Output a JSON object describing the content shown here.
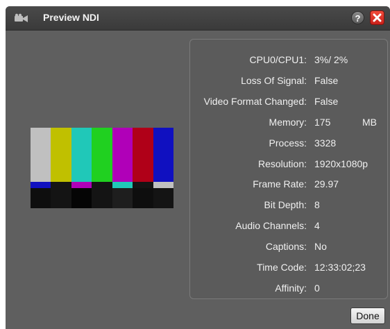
{
  "window": {
    "title": "Preview NDI",
    "help_label": "?",
    "icons": {
      "title": "video-camera-icon",
      "close": "close-icon"
    }
  },
  "info": {
    "rows": [
      {
        "label": "CPU0/CPU1:",
        "value": "3%/  2%"
      },
      {
        "label": "Loss Of Signal:",
        "value": "False"
      },
      {
        "label": "Video Format Changed:",
        "value": "False"
      },
      {
        "label": "Memory:",
        "value": "175",
        "unit": "MB"
      },
      {
        "label": "Process:",
        "value": "3328"
      },
      {
        "label": "Resolution:",
        "value": "1920x1080p"
      },
      {
        "label": "Frame Rate:",
        "value": "29.97"
      },
      {
        "label": "Bit Depth:",
        "value": "8"
      },
      {
        "label": "Audio Channels:",
        "value": "4"
      },
      {
        "label": "Captions:",
        "value": "No"
      },
      {
        "label": "Time Code:",
        "value": "12:33:02;23"
      },
      {
        "label": "Affinity:",
        "value": "0"
      }
    ]
  },
  "preview": {
    "top_bars": [
      "#c0c0c0",
      "#c0c000",
      "#20c8b8",
      "#20d020",
      "#b000b8",
      "#b00018",
      "#1010c0"
    ],
    "mid_bars": [
      "#1010c0",
      "#141414",
      "#b000b8",
      "#141414",
      "#20c8b8",
      "#141414",
      "#c0c0c0"
    ],
    "bottom_bars": [
      "#0e0e0e",
      "#141414",
      "#050505",
      "#141414",
      "#1e1e1e",
      "#0e0e0e",
      "#141414"
    ]
  },
  "footer": {
    "done_label": "Done"
  }
}
